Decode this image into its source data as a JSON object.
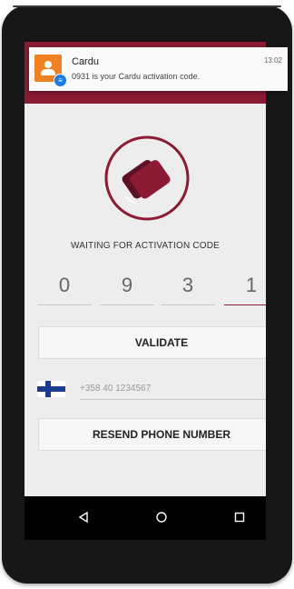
{
  "notification": {
    "app_name": "Cardu",
    "time": "13:02",
    "message": "0931 is your Cardu activation code."
  },
  "status": {
    "waiting_text": "WAITING FOR ACTIVATION CODE"
  },
  "code": {
    "digits": [
      "0",
      "9",
      "3",
      "1"
    ]
  },
  "buttons": {
    "validate_label": "VALIDATE",
    "resend_label": "RESEND PHONE NUMBER"
  },
  "phone": {
    "placeholder": "+358 40 1234567"
  },
  "colors": {
    "brand": "#8a1b33",
    "notification_icon": "#f08122",
    "flag_blue": "#1c3d8f"
  },
  "icons": {
    "logo": "cardu-logo-cards",
    "nav": [
      "back-icon",
      "home-icon",
      "recent-apps-icon"
    ]
  }
}
